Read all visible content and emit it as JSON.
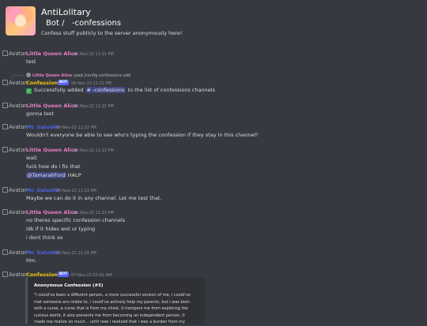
{
  "header": {
    "server_name": "AntiLolitary",
    "channel_line": "Bot /   -confessions",
    "description": "Confess stuff publicly to the server anonymously here!"
  },
  "colors": {
    "alice": "#e67ec6",
    "confessions": "#f1c40f",
    "redacted": "#4f63e8",
    "accent": "#5865f2",
    "success": "#3ba55c"
  },
  "avatar_alt": "Avatar",
  "bot_tag": "BOT",
  "messages": [
    {
      "author": "Little Queen Alice",
      "time": "06-Nov-22 11:21 PM",
      "lines": [
        "test"
      ]
    },
    {
      "reply": {
        "author": "Little Queen Alice",
        "text": "used /config confessions add"
      },
      "author": "Confessions",
      "time": "06-Nov-22 11:22 PM",
      "content": {
        "pre": "Successfully added",
        "channel": "#  -confessions",
        "post": "to the list of confessions channels"
      }
    },
    {
      "author": "Little Queen Alice",
      "time": "06-Nov-22 11:22 PM",
      "lines": [
        "gonna test"
      ]
    },
    {
      "author": "Mr. Satoshi",
      "time": "06-Nov-22 11:23 PM",
      "lines": [
        "Wouldn't everyone be able to see who's typing the confession if they stay in this channel?"
      ]
    },
    {
      "author": "Little Queen Alice",
      "time": "06-Nov-22 11:23 PM",
      "lines": [
        "wait",
        "fuck how do i fix that"
      ],
      "mention": "@TamarahFord",
      "mention_tail": "HALP"
    },
    {
      "author": "Mr. Satoshi",
      "time": "06-Nov-22 11:23 PM",
      "lines": [
        "Maybe we can do it in any channel. Let me test that."
      ]
    },
    {
      "author": "Little Queen Alice",
      "time": "06-Nov-22 11:23 PM",
      "lines": [
        "no theres specific confession channels",
        "idk if it hides wot ur typing",
        "i dont think so"
      ]
    },
    {
      "author": "Mr. Satoshi",
      "time": "06-Nov-22 11:24 PM",
      "lines": [
        "Hm."
      ]
    },
    {
      "author": "Confessions",
      "time": "07-Nov-22 07:41 AM",
      "embed": {
        "title": "Anonymous Confession (#5)",
        "lines": [
          "\"I could've been a different person, a more successful version of me, i could've",
          "met someone ans relate to, i could've actively help my parents, but i was born",
          "with a curse, a curse that is from my chest, it hampers me from exploring the",
          "curious world, it also prevents me from becoming an independent person, it",
          "made me realize so much... until now i realized that i was a burden from my"
        ]
      }
    }
  ]
}
